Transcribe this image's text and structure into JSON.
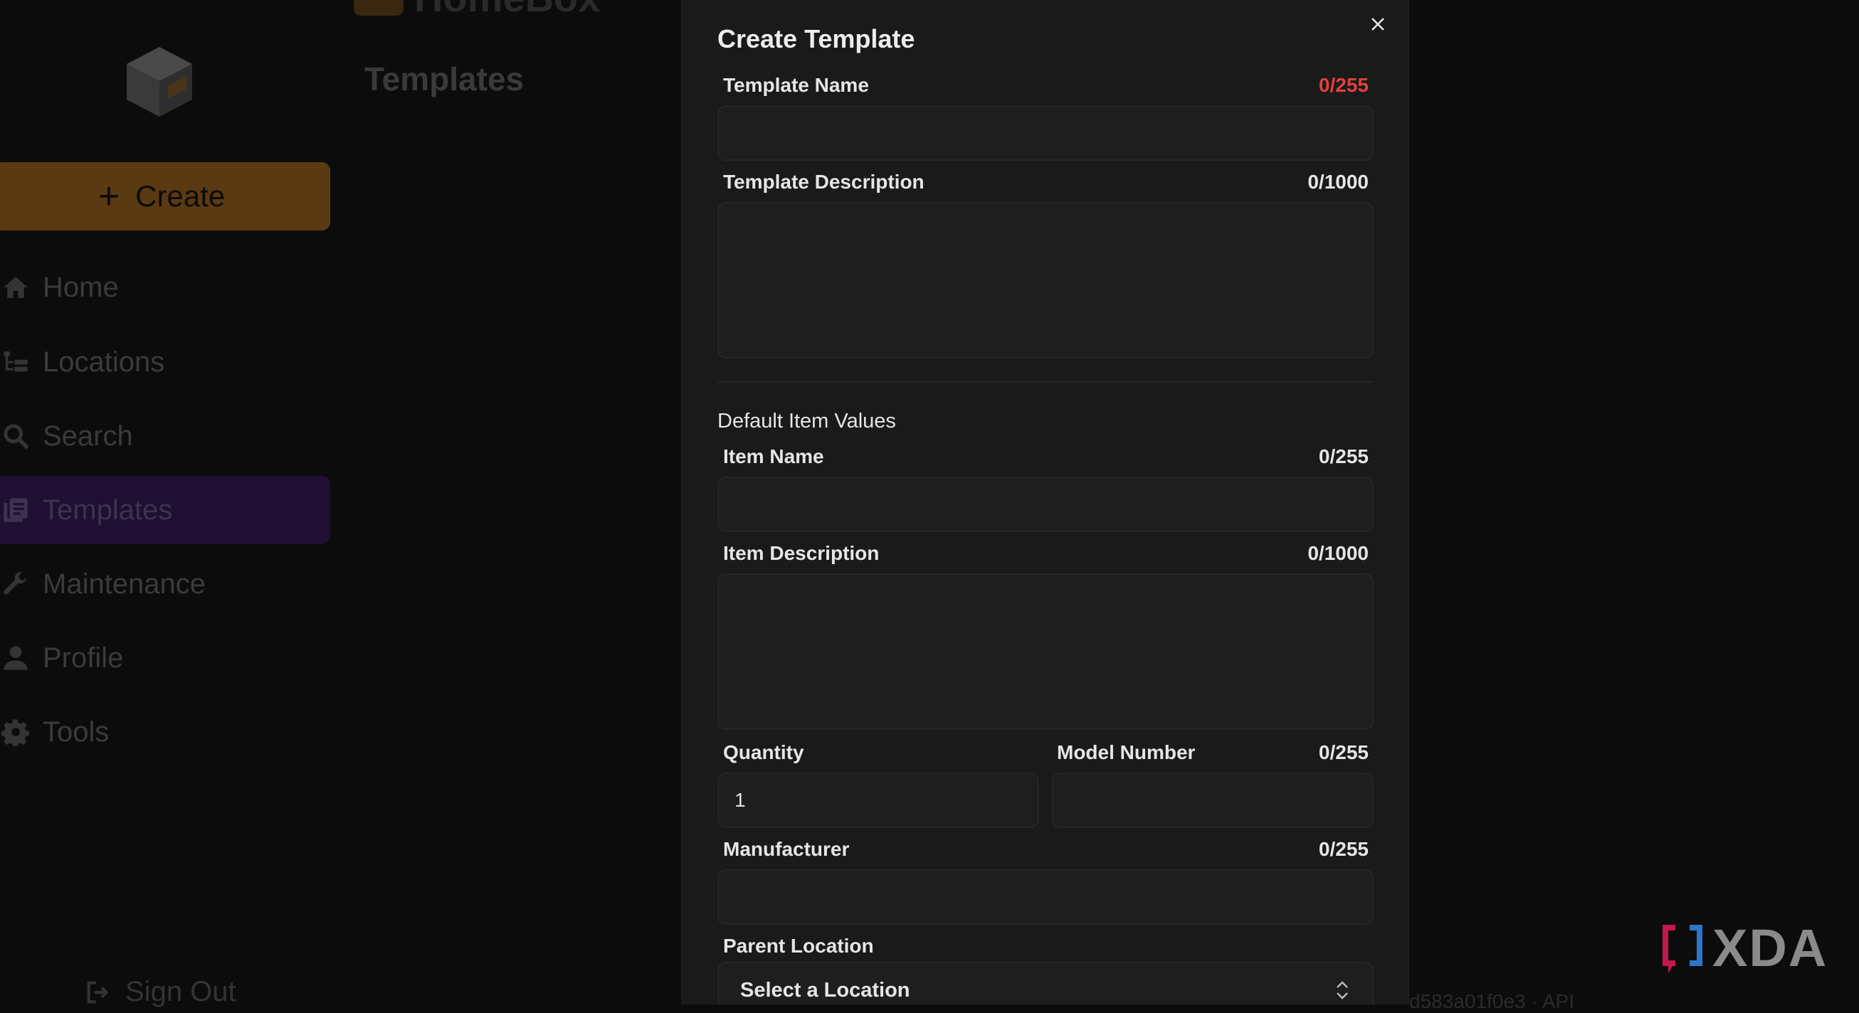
{
  "app": {
    "brand": "HomeBox",
    "create_label": "Create",
    "page_title": "Templates",
    "nav": [
      {
        "label": "Home",
        "icon": "home-icon"
      },
      {
        "label": "Locations",
        "icon": "locations-tree-icon"
      },
      {
        "label": "Search",
        "icon": "search-icon"
      },
      {
        "label": "Templates",
        "icon": "templates-icon",
        "active": true
      },
      {
        "label": "Maintenance",
        "icon": "wrench-icon"
      },
      {
        "label": "Profile",
        "icon": "user-icon"
      },
      {
        "label": "Tools",
        "icon": "gear-icon"
      }
    ],
    "sign_out": "Sign Out",
    "footer_hash": "d583a01f0e3 · API"
  },
  "modal": {
    "title": "Create Template",
    "template_name": {
      "label": "Template Name",
      "count": "0/255",
      "value": ""
    },
    "template_description": {
      "label": "Template Description",
      "count": "0/1000",
      "value": ""
    },
    "section_label": "Default Item Values",
    "item_name": {
      "label": "Item Name",
      "count": "0/255",
      "value": ""
    },
    "item_description": {
      "label": "Item Description",
      "count": "0/1000",
      "value": ""
    },
    "quantity": {
      "label": "Quantity",
      "value": "1"
    },
    "model_number": {
      "label": "Model Number",
      "count": "0/255",
      "value": ""
    },
    "manufacturer": {
      "label": "Manufacturer",
      "count": "0/255",
      "value": ""
    },
    "parent_location": {
      "label": "Parent Location",
      "selected": "Select a Location"
    }
  },
  "watermark": {
    "text": "XDA"
  },
  "colors": {
    "accent_orange": "#e58a1f",
    "accent_purple": "#6b2fd6",
    "counter_warn": "#e0413e",
    "modal_bg": "#1a1a1a"
  }
}
